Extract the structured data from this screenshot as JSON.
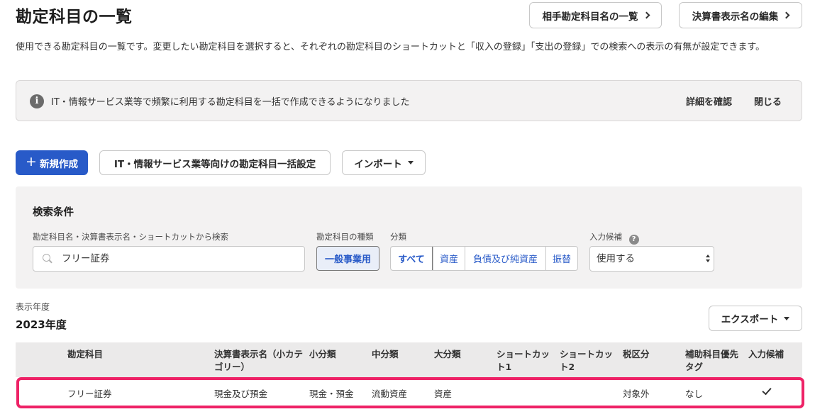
{
  "page": {
    "title": "勘定科目の一覧",
    "buttons": {
      "counterpart_list": "相手勘定科目名の一覧",
      "statement_names_edit": "決算書表示名の編集"
    },
    "description": "使用できる勘定科目の一覧です。変更したい勘定科目を選択すると、それぞれの勘定科目のショートカットと「収入の登録」「支出の登録」での検索への表示の有無が設定できます。"
  },
  "notice": {
    "icon": "info-icon",
    "text": "IT・情報サービス業等で頻繁に利用する勘定科目を一括で作成できるようになりました",
    "details_link": "詳細を確認",
    "close_link": "閉じる"
  },
  "actions": {
    "new_button": "新規作成",
    "bulk_setup_button": "IT・情報サービス業等向けの勘定科目一括設定",
    "import_button": "インポート"
  },
  "search": {
    "title": "検索条件",
    "keyword_label": "勘定科目名・決算書表示名・ショートカットから検索",
    "keyword_value": "フリー証券",
    "kind_label": "勘定科目の種類",
    "kind_value": "一般事業用",
    "category_label": "分類",
    "categories": [
      "すべて",
      "資産",
      "負債及び純資産",
      "振替"
    ],
    "candidate_label": "入力候補",
    "candidate_value": "使用する"
  },
  "year": {
    "label": "表示年度",
    "value": "2023年度"
  },
  "export_button": "エクスポート",
  "table": {
    "headers": {
      "account": "勘定科目",
      "statement_name": "決算書表示名（小カテゴリー）",
      "small": "小分類",
      "medium": "中分類",
      "large": "大分類",
      "shortcut1": "ショートカット1",
      "shortcut2": "ショートカット2",
      "tax": "税区分",
      "sub_tag": "補助科目優先タグ",
      "input_candidate": "入力候補"
    },
    "rows": [
      {
        "account": "フリー証券",
        "statement_name": "現金及び預金",
        "small": "現金・預金",
        "medium": "流動資産",
        "large": "資産",
        "shortcut1": "",
        "shortcut2": "",
        "tax": "対象外",
        "sub_tag": "なし",
        "input_candidate": "check"
      }
    ]
  },
  "colors": {
    "primary": "#285ac8",
    "highlight": "#ee2266"
  }
}
